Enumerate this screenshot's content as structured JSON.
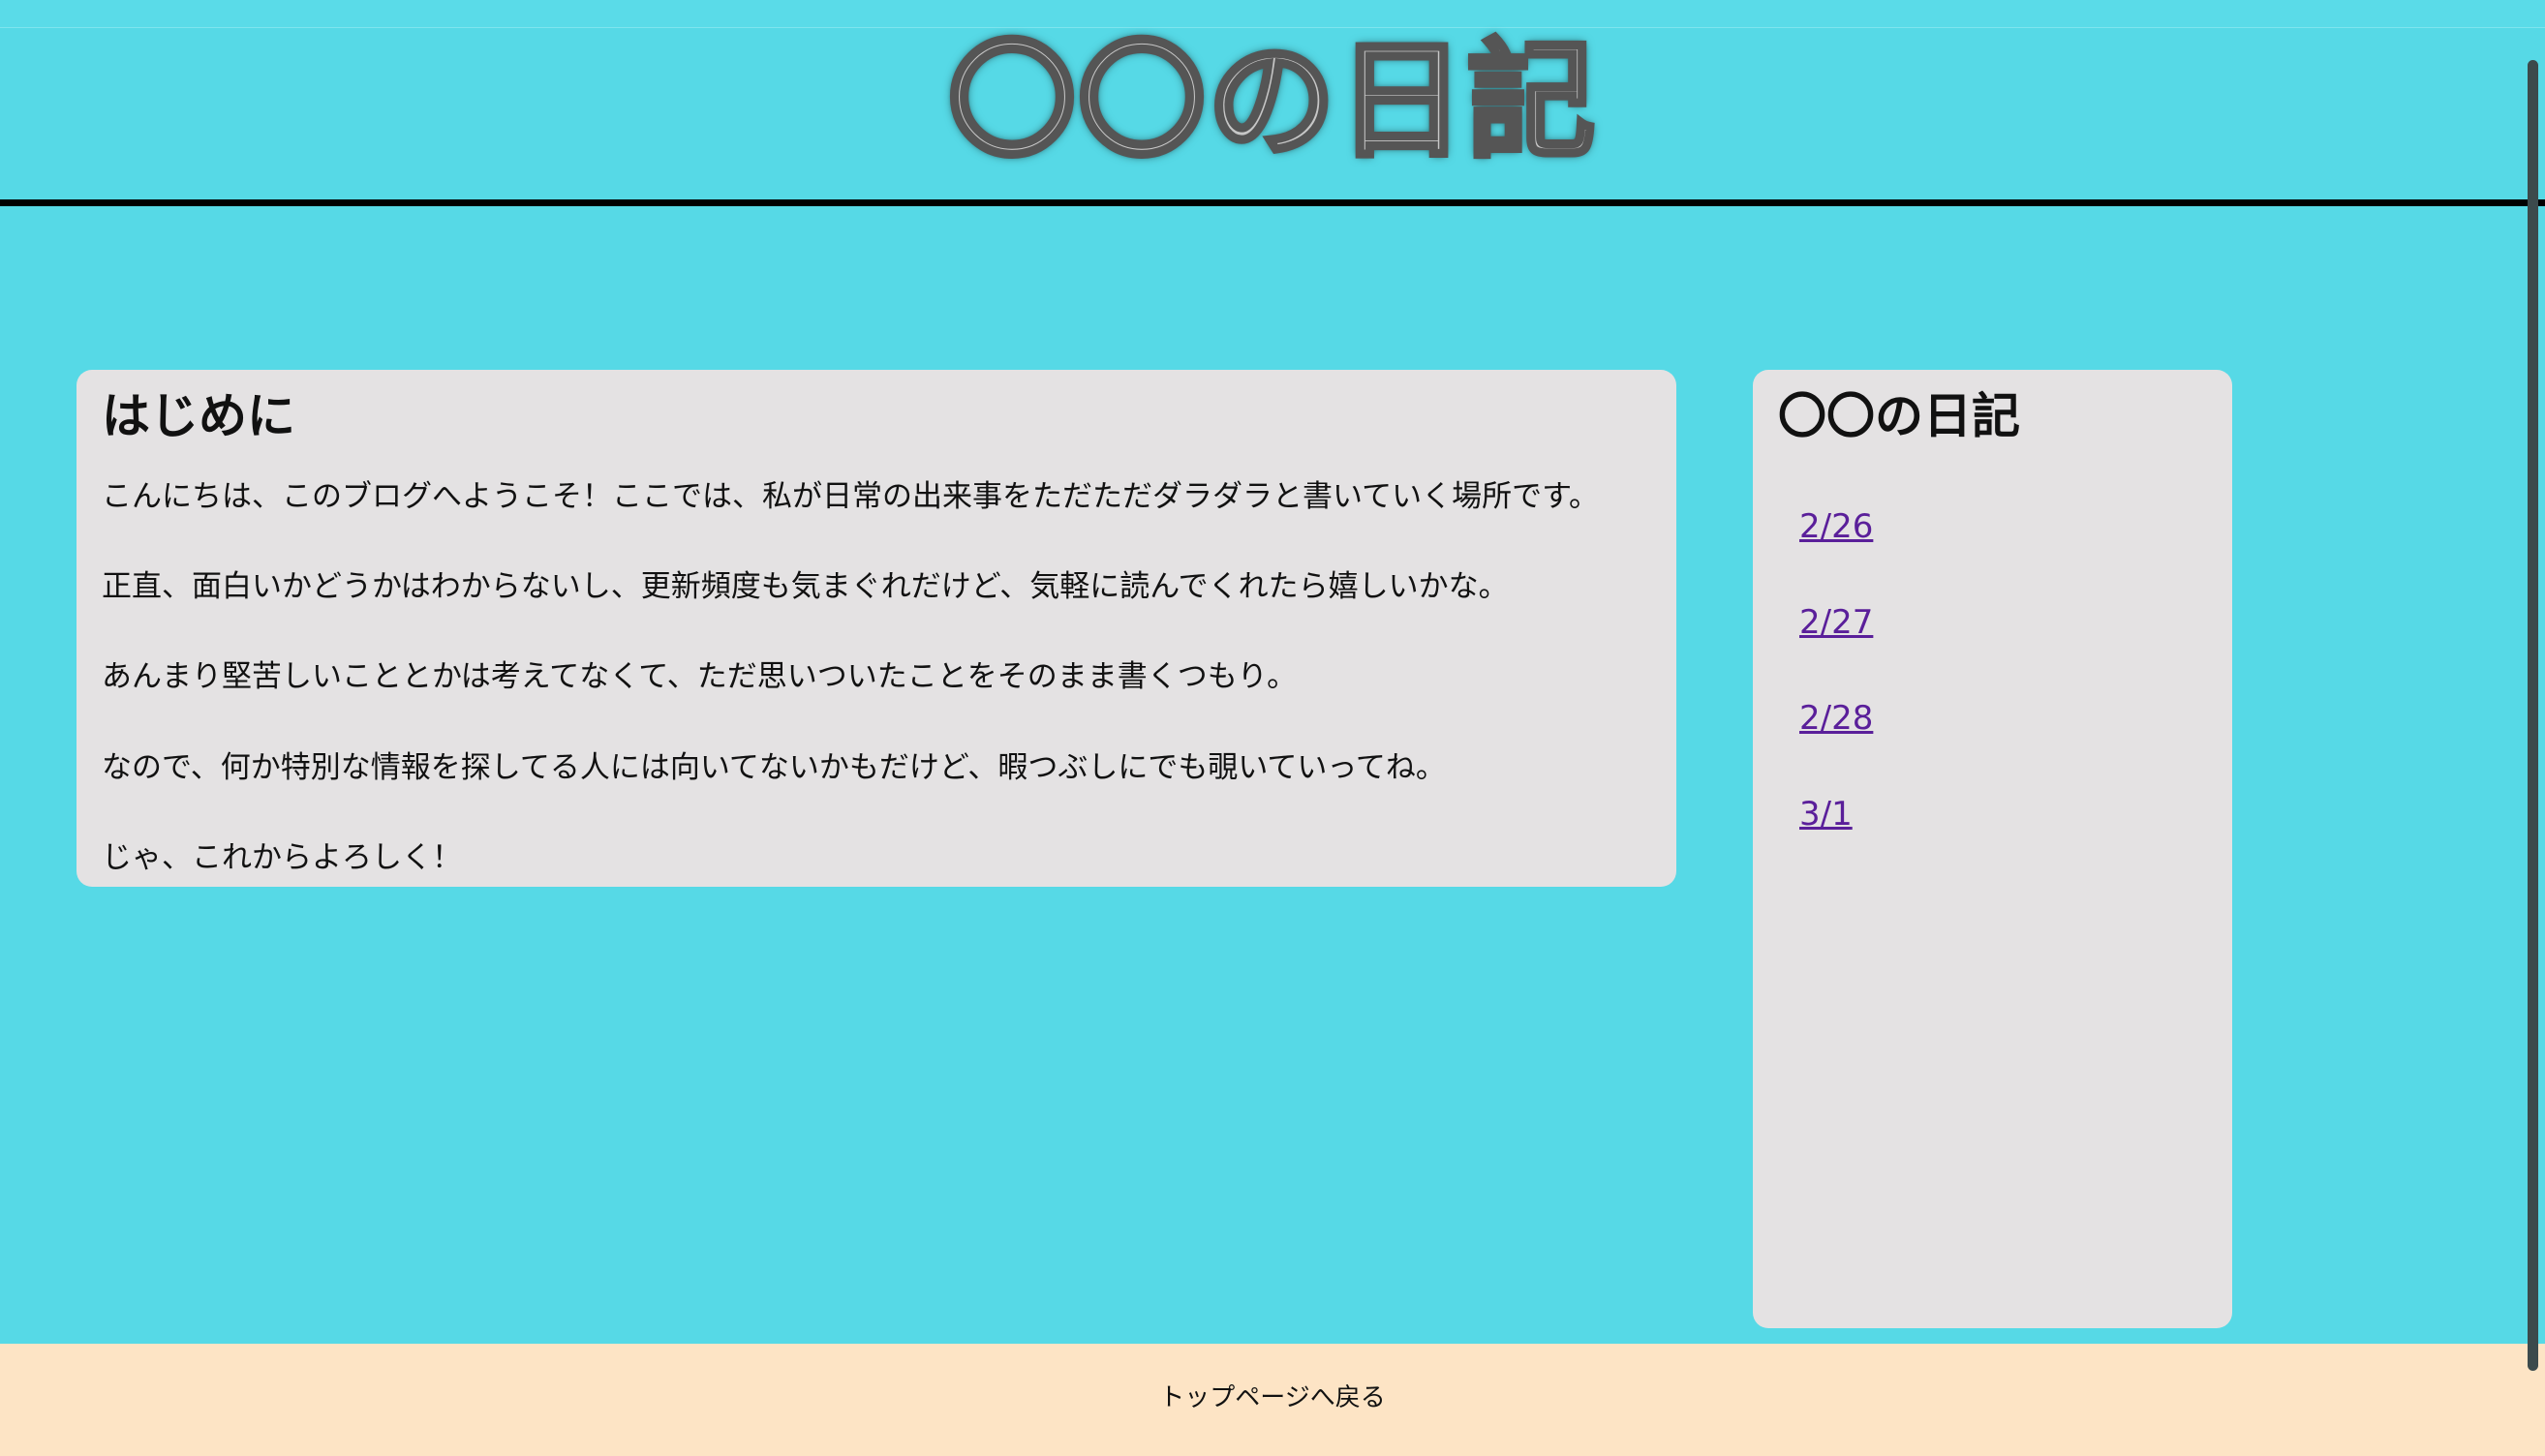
{
  "header": {
    "title": "〇〇の日記"
  },
  "main": {
    "heading": "はじめに",
    "paragraphs": [
      "こんにちは、このブログへようこそ！ここでは、私が日常の出来事をただただダラダラと書いていく場所です。",
      "正直、面白いかどうかはわからないし、更新頻度も気まぐれだけど、気軽に読んでくれたら嬉しいかな。",
      "あんまり堅苦しいこととかは考えてなくて、ただ思いついたことをそのまま書くつもり。",
      "なので、何か特別な情報を探してる人には向いてないかもだけど、暇つぶしにでも覗いていってね。",
      "じゃ、これからよろしく！"
    ]
  },
  "sidebar": {
    "title": "〇〇の日記",
    "links": [
      "2/26",
      "2/27",
      "2/28",
      "3/1"
    ]
  },
  "footer": {
    "back_link": "トップページへ戻る"
  },
  "colors": {
    "background": "#56d9e6",
    "card": "#e4e2e3",
    "footer": "#fde4c5",
    "link": "#5a1f9a"
  }
}
